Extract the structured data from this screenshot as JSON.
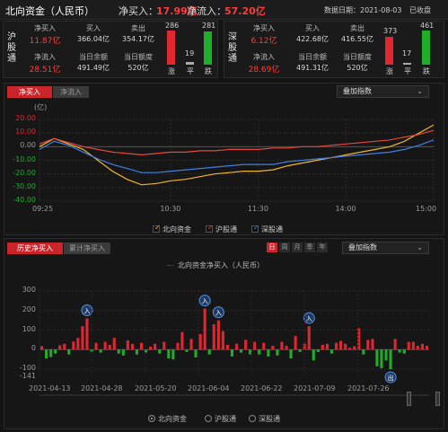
{
  "header": {
    "title": "北向资金（人民币）",
    "net_buy_label": "净买入：",
    "net_buy_value": "17.99亿",
    "net_inflow_label": "净流入：",
    "net_inflow_value": "57.20亿",
    "date": "数据日期：2021-08-03",
    "status": "已收盘"
  },
  "sh_panel": {
    "label": "沪股通",
    "net_buy_label": "净买入",
    "net_buy": "11.87亿",
    "net_inflow_label": "净流入",
    "net_inflow": "28.51亿",
    "buy_label": "买入",
    "buy": "366.04亿",
    "sell_label": "卖出",
    "sell": "354.17亿",
    "balance_label": "当日余额",
    "balance": "491.49亿",
    "quota_label": "当日额度",
    "quota": "520亿",
    "up": "286",
    "flat": "19",
    "down": "281",
    "up_label": "涨",
    "flat_label": "平",
    "down_label": "跌",
    "up_ratio": 1.0,
    "flat_ratio": 0.07,
    "down_ratio": 0.98
  },
  "sz_panel": {
    "label": "深股通",
    "net_buy_label": "净买入",
    "net_buy": "6.12亿",
    "net_inflow_label": "净流入",
    "net_inflow": "28.69亿",
    "buy_label": "买入",
    "buy": "422.68亿",
    "sell_label": "卖出",
    "sell": "416.55亿",
    "balance_label": "当日余额",
    "balance": "491.31亿",
    "quota_label": "当日额度",
    "quota": "520亿",
    "up": "373",
    "flat": "17",
    "down": "461",
    "up_label": "涨",
    "flat_label": "平",
    "down_label": "跌",
    "up_ratio": 0.81,
    "flat_ratio": 0.04,
    "down_ratio": 1.0
  },
  "intraday": {
    "tab_net_buy": "净买入",
    "tab_net_inflow": "净流入",
    "overlay_label": "叠加指数",
    "legend": [
      "北向资金",
      "沪股通",
      "深股通"
    ]
  },
  "history": {
    "tab_history": "历史净买入",
    "tab_cumulative": "累计净买入",
    "periods": [
      "日",
      "周",
      "月",
      "季",
      "年"
    ],
    "overlay_label": "叠加指数",
    "legend_label": "北向资金净买入（人民币）",
    "marker_in": "入",
    "marker_out": "出",
    "radios": [
      "北向资金",
      "沪股通",
      "深股通"
    ]
  },
  "colors": {
    "up": "#e0272f",
    "down": "#1fad2a",
    "north": "#f0b429",
    "sh": "#e5483a",
    "sz": "#3f7ee6",
    "accent": "#c9252b"
  },
  "chart_data": [
    {
      "type": "line",
      "title": "",
      "ylabel": "(亿)",
      "ylim": [
        -40,
        20
      ],
      "yticks": [
        "20.00",
        "10.00",
        "0.00",
        "-10.00",
        "-20.00",
        "-30.00",
        "-40.00"
      ],
      "xticks": [
        "09:25",
        "10:30",
        "11:30",
        "14:00",
        "15:00"
      ],
      "x": [
        "09:25",
        "09:30",
        "09:35",
        "09:40",
        "09:45",
        "09:50",
        "10:00",
        "10:10",
        "10:20",
        "10:30",
        "10:40",
        "10:50",
        "11:00",
        "11:10",
        "11:20",
        "11:30",
        "13:10",
        "13:20",
        "13:30",
        "13:40",
        "13:50",
        "14:00",
        "14:10",
        "14:20",
        "14:30",
        "14:40",
        "14:50",
        "15:00"
      ],
      "series": [
        {
          "name": "北向资金",
          "values": [
            0,
            6,
            2,
            -2,
            -10,
            -18,
            -24,
            -28,
            -27,
            -25,
            -24,
            -22,
            -20,
            -19,
            -18,
            -18,
            -17,
            -14,
            -12,
            -10,
            -8,
            -6,
            -4,
            -2,
            0,
            4,
            10,
            16
          ]
        },
        {
          "name": "沪股通",
          "values": [
            2,
            6,
            3,
            0,
            -2,
            -4,
            -5,
            -6,
            -5,
            -4,
            -4,
            -3,
            -3,
            -2,
            -2,
            -2,
            -1,
            -1,
            0,
            0,
            1,
            2,
            3,
            4,
            5,
            7,
            9,
            12
          ]
        },
        {
          "name": "深股通",
          "values": [
            -2,
            4,
            1,
            -4,
            -9,
            -13,
            -16,
            -19,
            -19,
            -18,
            -17,
            -16,
            -15,
            -14,
            -13,
            -13,
            -13,
            -11,
            -10,
            -9,
            -8,
            -7,
            -6,
            -5,
            -4,
            -2,
            1,
            5
          ]
        }
      ]
    },
    {
      "type": "bar",
      "title": "北向资金净买入（人民币）",
      "ylim": [
        -141,
        300
      ],
      "yticks": [
        "300",
        "200",
        "100",
        "0",
        "-100",
        "-141"
      ],
      "xticks": [
        "2021-04-13",
        "2021-04-28",
        "2021-05-20",
        "2021-06-04",
        "2021-06-22",
        "2021-07-09",
        "2021-07-26"
      ],
      "values": [
        18,
        -45,
        -38,
        -20,
        22,
        30,
        -25,
        42,
        60,
        120,
        160,
        -10,
        35,
        -15,
        40,
        25,
        60,
        -20,
        -30,
        48,
        30,
        -25,
        35,
        -15,
        15,
        30,
        -20,
        40,
        -45,
        -50,
        35,
        90,
        -12,
        55,
        -40,
        80,
        210,
        -25,
        130,
        150,
        95,
        25,
        -35,
        30,
        -15,
        50,
        -25,
        40,
        -25,
        35,
        -35,
        20,
        -30,
        40,
        20,
        -45,
        70,
        -12,
        30,
        120,
        -55,
        -12,
        25,
        30,
        -20,
        35,
        45,
        30,
        10,
        18,
        110,
        -25,
        50,
        55,
        -85,
        -95,
        -55,
        -100,
        55,
        -15,
        -20,
        40,
        40,
        20,
        30,
        20
      ],
      "markers": [
        {
          "index": 10,
          "label": "入"
        },
        {
          "index": 36,
          "label": "入"
        },
        {
          "index": 39,
          "label": "入"
        },
        {
          "index": 59,
          "label": "入"
        },
        {
          "index": 77,
          "label": "出"
        }
      ]
    }
  ]
}
